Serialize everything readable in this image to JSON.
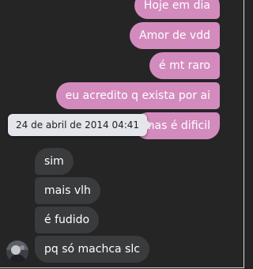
{
  "messages": {
    "outgoing": [
      {
        "text": "Hoje em dia"
      },
      {
        "text": "Amor de vdd"
      },
      {
        "text": "é mt raro"
      },
      {
        "text": "eu acredito q exista por ai"
      },
      {
        "text": "mas é dificil"
      }
    ],
    "incoming": [
      {
        "text": "sim"
      },
      {
        "text": "mais vlh"
      },
      {
        "text": "é fudido"
      },
      {
        "text": "pq só machca slc"
      }
    ]
  },
  "timestamp_tooltip": {
    "text": "24 de abril de 2014 04:41"
  },
  "contact": {
    "avatar_icon": "profile-photo"
  },
  "colors": {
    "background": "#252526",
    "outgoing_bubble": "#d38bbd",
    "incoming_bubble": "#3a3b3c",
    "tooltip_bg": "#e4e6eb"
  }
}
